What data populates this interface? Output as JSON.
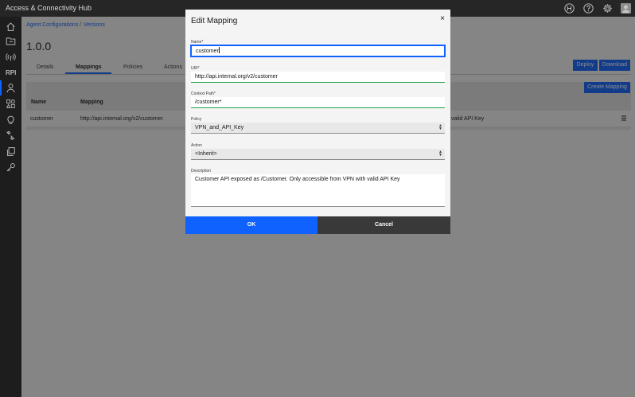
{
  "app": {
    "title": "Access & Connectivity Hub"
  },
  "header_icons": [
    "hub-logo-icon",
    "help-icon",
    "gear-icon",
    "user-avatar"
  ],
  "sidebar": {
    "items": [
      {
        "icon": "home-icon"
      },
      {
        "icon": "folder-icon"
      },
      {
        "icon": "radio-icon"
      },
      {
        "icon": "api-icon",
        "text": "RPI"
      },
      {
        "icon": "agent-icon",
        "active": true
      },
      {
        "icon": "apps-icon"
      },
      {
        "icon": "lightbulb-icon"
      },
      {
        "icon": "wrench-icon"
      },
      {
        "icon": "copy-icon"
      },
      {
        "icon": "key-icon"
      }
    ]
  },
  "breadcrumb": {
    "items": [
      "Agent Configurations",
      "Versions"
    ],
    "separator": "/"
  },
  "version_title": "1.0.0",
  "tabs": [
    {
      "label": "Details"
    },
    {
      "label": "Mappings",
      "active": true
    },
    {
      "label": "Policies"
    },
    {
      "label": "Actions"
    }
  ],
  "buttons": {
    "deploy": "Deploy",
    "download": "Download",
    "create_mapping": "Create Mapping"
  },
  "table": {
    "headers": [
      "Name",
      "Mapping"
    ],
    "rows": [
      {
        "name": "customer",
        "mapping": "http://api.internal.org/v2/customer",
        "trailing": "valid API Key"
      }
    ]
  },
  "modal": {
    "title": "Edit Mapping",
    "close": "×",
    "fields": {
      "name": {
        "label": "Name*",
        "value": "customer"
      },
      "uri": {
        "label": "URI*",
        "value": "http://api.internal.org/v2/customer"
      },
      "context_path": {
        "label": "Context Path*",
        "value": "/customer*"
      },
      "policy": {
        "label": "Policy",
        "value": "VPN_and_API_Key"
      },
      "action": {
        "label": "Action",
        "value": "<Inherit>"
      },
      "description": {
        "label": "Description",
        "value": "Customer API exposed as /Customer. Only accessible from VPN with valid API Key"
      }
    },
    "ok": "OK",
    "cancel": "Cancel"
  },
  "colors": {
    "accent": "#0f62fe",
    "topbar": "#262626",
    "sidebar": "#1d1d1d",
    "valid": "#24a148"
  }
}
